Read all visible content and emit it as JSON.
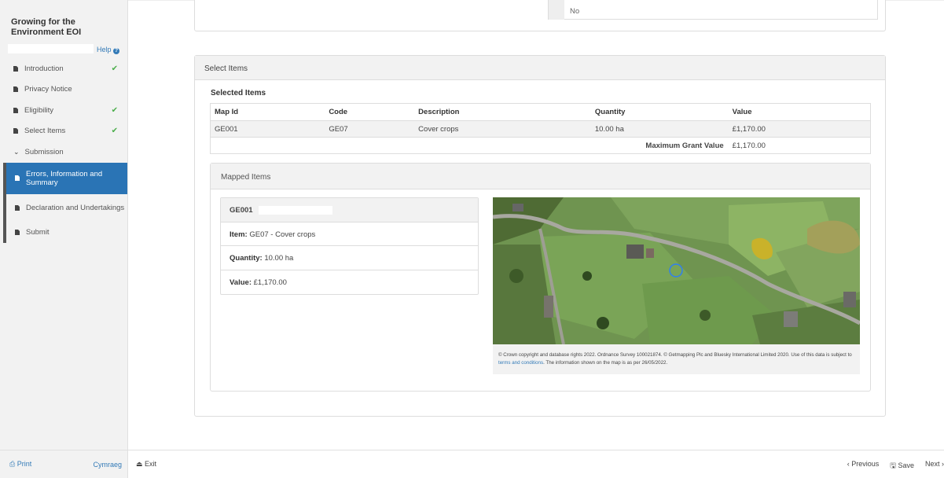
{
  "sidebar": {
    "title": "Growing for the Environment EOI",
    "help_label": "Help",
    "items": [
      {
        "label": "Introduction",
        "complete": true
      },
      {
        "label": "Privacy Notice",
        "complete": false
      },
      {
        "label": "Eligibility",
        "complete": true
      },
      {
        "label": "Select Items",
        "complete": true
      }
    ],
    "group_label": "Submission",
    "sub_items": [
      {
        "label": "Errors, Information and Summary",
        "active": true
      },
      {
        "label": "Declaration and Undertakings",
        "active": false
      },
      {
        "label": "Submit",
        "active": false
      }
    ],
    "print_label": "Print",
    "language_label": "Cymraeg"
  },
  "top_panel": {
    "option_label": "No"
  },
  "select_items": {
    "panel_title": "Select Items",
    "selected_title": "Selected Items",
    "columns": [
      "Map Id",
      "Code",
      "Description",
      "Quantity",
      "Value"
    ],
    "rows": [
      [
        "GE001",
        "GE07",
        "Cover crops",
        "10.00 ha",
        "£1,170.00"
      ]
    ],
    "max_grant_label": "Maximum Grant Value",
    "max_grant_value": "£1,170.00"
  },
  "mapped_items": {
    "title": "Mapped Items",
    "card_id": "GE001",
    "item_label": "Item:",
    "item_value": "GE07 - Cover crops",
    "quantity_label": "Quantity:",
    "quantity_value": "10.00 ha",
    "value_label": "Value:",
    "value_value": "£1,170.00",
    "attribution_text": "© Crown copyright and database rights 2022. Ordnance Survey 100021874. © Getmapping Plc and Bluesky International Limited 2020. Use of this data is subject to ",
    "attribution_link": "terms and conditions",
    "attribution_tail": ". The information shown on the map is as per 26/05/2022."
  },
  "footer": {
    "exit_label": "Exit",
    "previous_label": "Previous",
    "save_label": "Save",
    "next_label": "Next"
  },
  "colors": {
    "accent": "#2a74b5",
    "check": "#4cae4c",
    "link": "#337ab7"
  }
}
